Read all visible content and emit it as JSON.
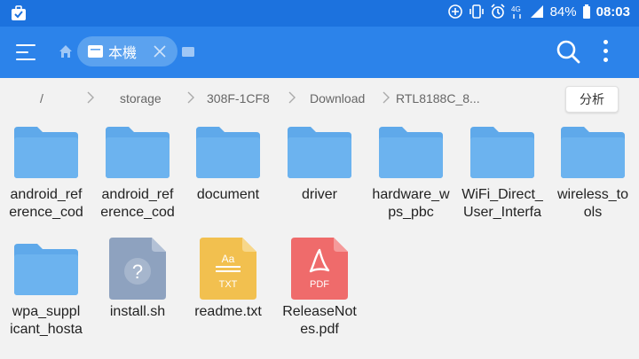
{
  "status_bar": {
    "left_icon": "briefcase-check-icon",
    "icons": [
      "add-circle-icon",
      "vibrate-icon",
      "alarm-icon",
      "4g-icon",
      "signal-icon"
    ],
    "battery": "84%",
    "time": "08:03",
    "network_label": "4G"
  },
  "toolbar": {
    "menu_icon": "menu-icon",
    "home_icon": "home-icon",
    "location_label": "本機",
    "close_icon": "close-icon",
    "window_icon": "window-icon",
    "search_icon": "search-icon",
    "more_icon": "more-vert-icon"
  },
  "breadcrumb": {
    "items": [
      "/",
      "storage",
      "308F-1CF8",
      "Download",
      "RTL8188C_8..."
    ],
    "analyze_label": "分析"
  },
  "colors": {
    "status_bar": "#1c72de",
    "toolbar": "#2c83ea",
    "chip": "#5ba2ef",
    "folder": "#5fa9ea",
    "folder_tab": "#4d97dc",
    "unknown_file": "#8ea2bf",
    "txt_file": "#f2c04f",
    "pdf_file": "#ef6b6b"
  },
  "files": [
    {
      "name_line1": "android_ref",
      "name_line2": "erence_cod",
      "type": "folder",
      "icon": "folder-icon"
    },
    {
      "name_line1": "android_ref",
      "name_line2": "erence_cod",
      "type": "folder",
      "icon": "folder-icon"
    },
    {
      "name_line1": "document",
      "name_line2": "",
      "type": "folder",
      "icon": "folder-icon"
    },
    {
      "name_line1": "driver",
      "name_line2": "",
      "type": "folder",
      "icon": "folder-icon"
    },
    {
      "name_line1": "hardware_w",
      "name_line2": "ps_pbc",
      "type": "folder",
      "icon": "folder-icon"
    },
    {
      "name_line1": "WiFi_Direct_",
      "name_line2": "User_Interfa",
      "type": "folder",
      "icon": "folder-icon"
    },
    {
      "name_line1": "wireless_to",
      "name_line2": "ols",
      "type": "folder",
      "icon": "folder-icon"
    },
    {
      "name_line1": "wpa_suppl",
      "name_line2": "icant_hosta",
      "type": "folder",
      "icon": "folder-icon"
    },
    {
      "name_line1": "install.sh",
      "name_line2": "",
      "type": "unknown",
      "icon": "unknown-file-icon",
      "glyph": "?"
    },
    {
      "name_line1": "readme.txt",
      "name_line2": "",
      "type": "txt",
      "icon": "text-file-icon",
      "glyph_top": "Aa",
      "glyph": "TXT"
    },
    {
      "name_line1": "ReleaseNot",
      "name_line2": "es.pdf",
      "type": "pdf",
      "icon": "pdf-file-icon",
      "glyph": "PDF"
    }
  ]
}
